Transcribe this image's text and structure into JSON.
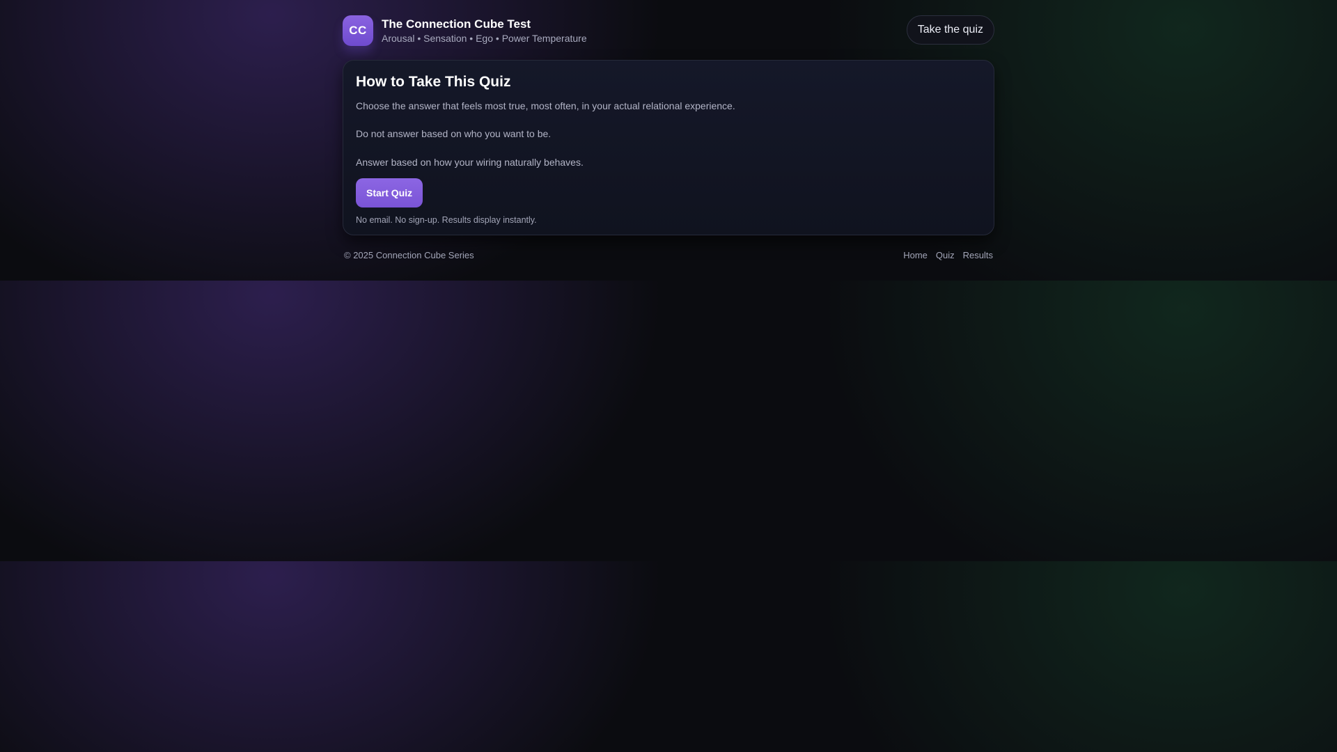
{
  "brand": {
    "logo_text": "CC",
    "title": "The Connection Cube Test",
    "subtitle": "Arousal • Sensation • Ego • Power Temperature"
  },
  "header": {
    "take_quiz_label": "Take the quiz"
  },
  "card": {
    "title": "How to Take This Quiz",
    "paragraphs": [
      "Choose the answer that feels most true, most often, in your actual relational experience.",
      "Do not answer based on who you want to be.",
      "Answer based on how your wiring naturally behaves."
    ],
    "start_label": "Start Quiz",
    "note": "No email. No sign-up. Results display instantly."
  },
  "footer": {
    "copyright": "© 2025 Connection Cube Series",
    "links": [
      "Home",
      "Quiz",
      "Results"
    ]
  },
  "colors": {
    "accent": "#7a54d6",
    "background": "#0b0c10",
    "card": "#12152a"
  }
}
